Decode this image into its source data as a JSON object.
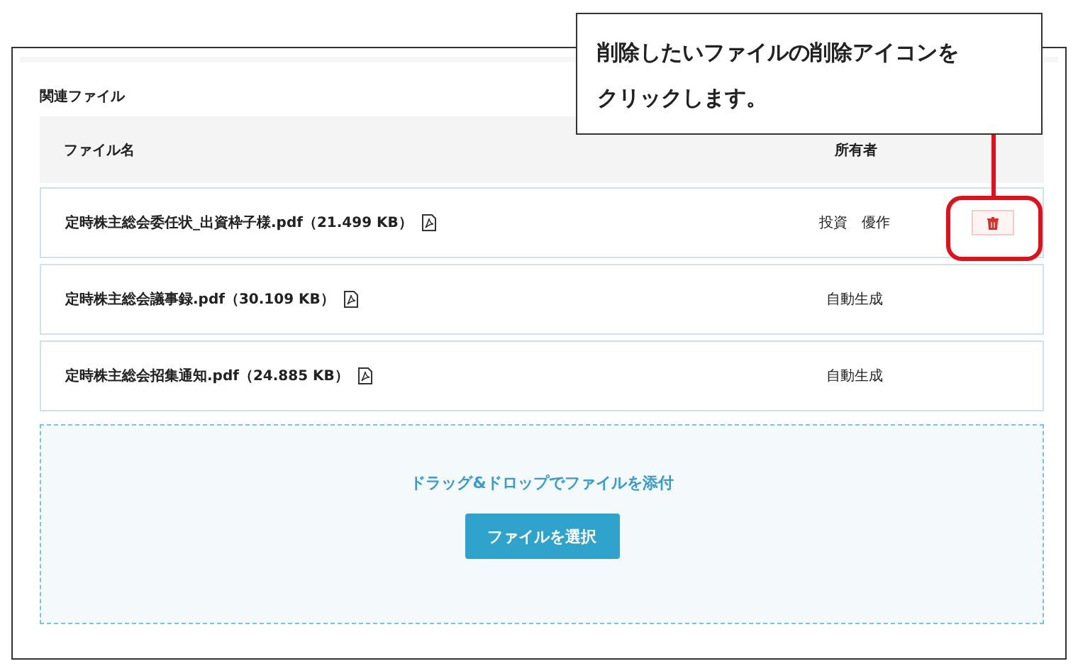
{
  "section_title": "関連ファイル",
  "table": {
    "columns": [
      "ファイル名",
      "所有者"
    ],
    "rows": [
      {
        "file": "定時株主総会委任状_出資枠子様.pdf（21.499 KB）",
        "owner": "投資　優作",
        "deletable": true
      },
      {
        "file": "定時株主総会議事録.pdf（30.109 KB）",
        "owner": "自動生成",
        "deletable": false
      },
      {
        "file": "定時株主総会招集通知.pdf（24.885 KB）",
        "owner": "自動生成",
        "deletable": false
      }
    ]
  },
  "dropzone": {
    "hint": "ドラッグ&ドロップでファイルを添付",
    "button": "ファイルを選択"
  },
  "callout": {
    "text": "削除したいファイルの削除アイコンをクリックします。"
  }
}
